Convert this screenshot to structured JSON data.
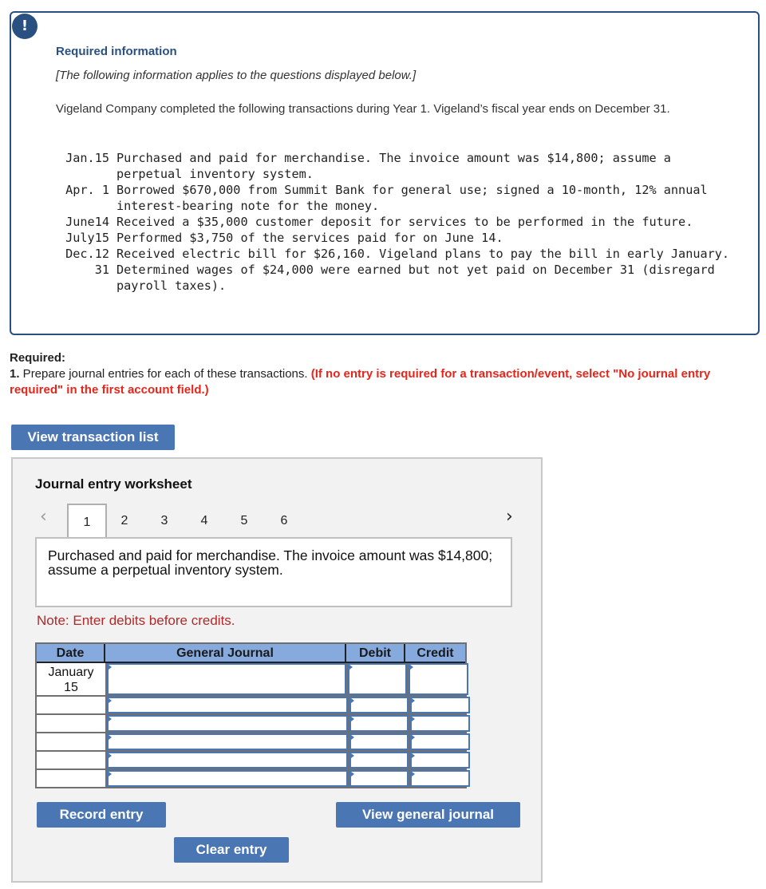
{
  "info": {
    "icon": "exclamation-icon",
    "title": "Required information",
    "subtitle": "[The following information applies to the questions displayed below.]",
    "intro": "Vigeland Company completed the following transactions during Year 1. Vigeland’s fiscal year ends on December 31.",
    "transactions": [
      {
        "date": "Jan.15",
        "desc": "Purchased and paid for merchandise. The invoice amount was $14,800; assume a perpetual inventory system."
      },
      {
        "date": "Apr. 1",
        "desc": "Borrowed $670,000 from Summit Bank for general use; signed a 10-month, 12% annual interest-bearing note for the money."
      },
      {
        "date": "June14",
        "desc": "Received a $35,000 customer deposit for services to be performed in the future."
      },
      {
        "date": "July15",
        "desc": "Performed $3,750 of the services paid for on June 14."
      },
      {
        "date": "Dec.12",
        "desc": "Received electric bill for $26,160. Vigeland plans to pay the bill in early January."
      },
      {
        "date": "31",
        "desc": "Determined wages of $24,000 were earned but not yet paid on December 31 (disregard payroll taxes)."
      }
    ]
  },
  "required": {
    "label": "Required:",
    "number": "1.",
    "text": " Prepare journal entries for each of these transactions. ",
    "instruction": "(If no entry is required for a transaction/event, select \"No journal entry required\" in the first account field.)"
  },
  "buttons": {
    "view_transaction_list": "View transaction list",
    "record_entry": "Record entry",
    "view_general_journal": "View general journal",
    "clear_entry": "Clear entry"
  },
  "worksheet": {
    "title": "Journal entry worksheet",
    "prev_icon": "‹",
    "next_icon": "›",
    "tabs": [
      "1",
      "2",
      "3",
      "4",
      "5",
      "6"
    ],
    "active_tab": "1",
    "description": "Purchased and paid for merchandise. The invoice amount was $14,800; assume a perpetual inventory system.",
    "note": "Note: Enter debits before credits.",
    "journal": {
      "headers": {
        "date": "Date",
        "account": "General Journal",
        "debit": "Debit",
        "credit": "Credit"
      },
      "rows": [
        {
          "date_line1": "January",
          "date_line2": "15",
          "account": "",
          "debit": "",
          "credit": ""
        },
        {
          "date_line1": "",
          "date_line2": "",
          "account": "",
          "debit": "",
          "credit": ""
        },
        {
          "date_line1": "",
          "date_line2": "",
          "account": "",
          "debit": "",
          "credit": ""
        },
        {
          "date_line1": "",
          "date_line2": "",
          "account": "",
          "debit": "",
          "credit": ""
        },
        {
          "date_line1": "",
          "date_line2": "",
          "account": "",
          "debit": "",
          "credit": ""
        },
        {
          "date_line1": "",
          "date_line2": "",
          "account": "",
          "debit": "",
          "credit": ""
        }
      ]
    }
  },
  "colors": {
    "info_border": "#2a5082",
    "button_bg": "#4a76b3",
    "instruction_red": "#e8251b",
    "note_red": "#b02a2a",
    "table_header": "#86aadd"
  }
}
